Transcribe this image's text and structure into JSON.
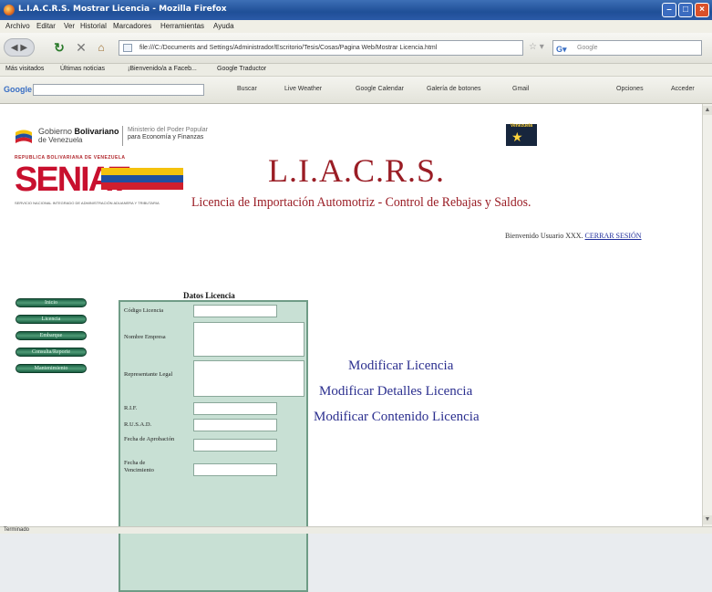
{
  "window": {
    "title": "L.I.A.C.R.S. Mostrar Licencia - Mozilla Firefox"
  },
  "menu": [
    "Archivo",
    "Editar",
    "Ver",
    "Historial",
    "Marcadores",
    "Herramientas",
    "Ayuda"
  ],
  "address_bar": {
    "url": "file:///C:/Documents and Settings/Administrador/Escritorio/Tesis/Cosas/Pagina Web/Mostrar Licencia.html"
  },
  "search_box": {
    "placeholder": "Google"
  },
  "bookmarks": [
    "Más visitados",
    "Últimas noticias",
    "¡Bienvenido/a a Faceb...",
    "Google Traductor"
  ],
  "google_toolbar": {
    "logo": "Google",
    "items": [
      "Buscar",
      "Live Weather",
      "Google Calendar",
      "Galería de botones",
      "Gmail",
      "Opciones",
      "Acceder"
    ]
  },
  "gov_header": {
    "line1_prefix": "Gobierno ",
    "line1_bold": "Bolivariano",
    "line2": "de Venezuela",
    "ministry_line1": "Ministerio del Poder Popular",
    "ministry_line2": "para Economía y Finanzas"
  },
  "badge": {
    "label": "Venezuela"
  },
  "seniat": {
    "top": "REPUBLICA BOLIVARIANA DE VENEZUELA",
    "name": "SENIAT",
    "sub": "SERVICIO NACIONAL INTEGRADO DE ADMINISTRACIÓN ADUANERA Y TRIBUTARIA"
  },
  "app": {
    "title": "L.I.A.C.R.S.",
    "subtitle": "Licencia de Importación Automotriz - Control de Rebajas y Saldos."
  },
  "welcome": {
    "text": "Bienvenido Usuario XXX.",
    "logout": "CERRAR SESIÓN"
  },
  "sidebar": [
    "Inicio",
    "Licencia",
    "Embarque",
    "Consulta/Reporte",
    "Mantenimiento"
  ],
  "form": {
    "title": "Datos Licencia",
    "fields": [
      {
        "label": "Código Licencia",
        "value": ""
      },
      {
        "label": "Nombre Empresa",
        "value": ""
      },
      {
        "label": "Representante Legal",
        "value": ""
      },
      {
        "label": "R.I.F.",
        "value": ""
      },
      {
        "label": "R.U.S.A.D.",
        "value": ""
      },
      {
        "label": "Fecha de Aprobación",
        "value": ""
      },
      {
        "label": "Fecha de Vencimiento",
        "value": ""
      }
    ]
  },
  "actions": [
    "Modificar Licencia",
    "Modificar Detalles Licencia",
    "Modificar Contenido Licencia"
  ],
  "status": "Terminado",
  "colors": {
    "title_red": "#9a1d25",
    "link_blue": "#2b2f8f",
    "button_green": "#2c7a57",
    "form_bg": "#c8e0d4"
  }
}
